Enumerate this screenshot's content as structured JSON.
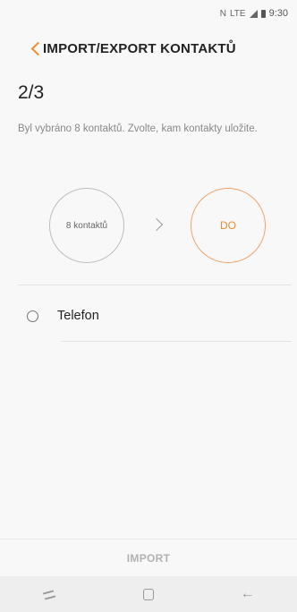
{
  "status_bar": {
    "icons": [
      "nfc-icon",
      "lte-icon",
      "signal-icon",
      "battery-icon"
    ],
    "lte": "LTE",
    "time": "9:30"
  },
  "header": {
    "title": "IMPORT/EXPORT KONTAKTŮ",
    "accent_color": "#f08a2c"
  },
  "step": "2/3",
  "description": "Byl vybráno 8 kontaktů. Zvolte, kam kontakty uložite.",
  "flow": {
    "from_label": "8 kontaktů",
    "to_label": "DO"
  },
  "options": [
    {
      "label": "Telefon",
      "selected": false
    }
  ],
  "footer": {
    "import_label": "IMPORT",
    "import_enabled": false
  }
}
